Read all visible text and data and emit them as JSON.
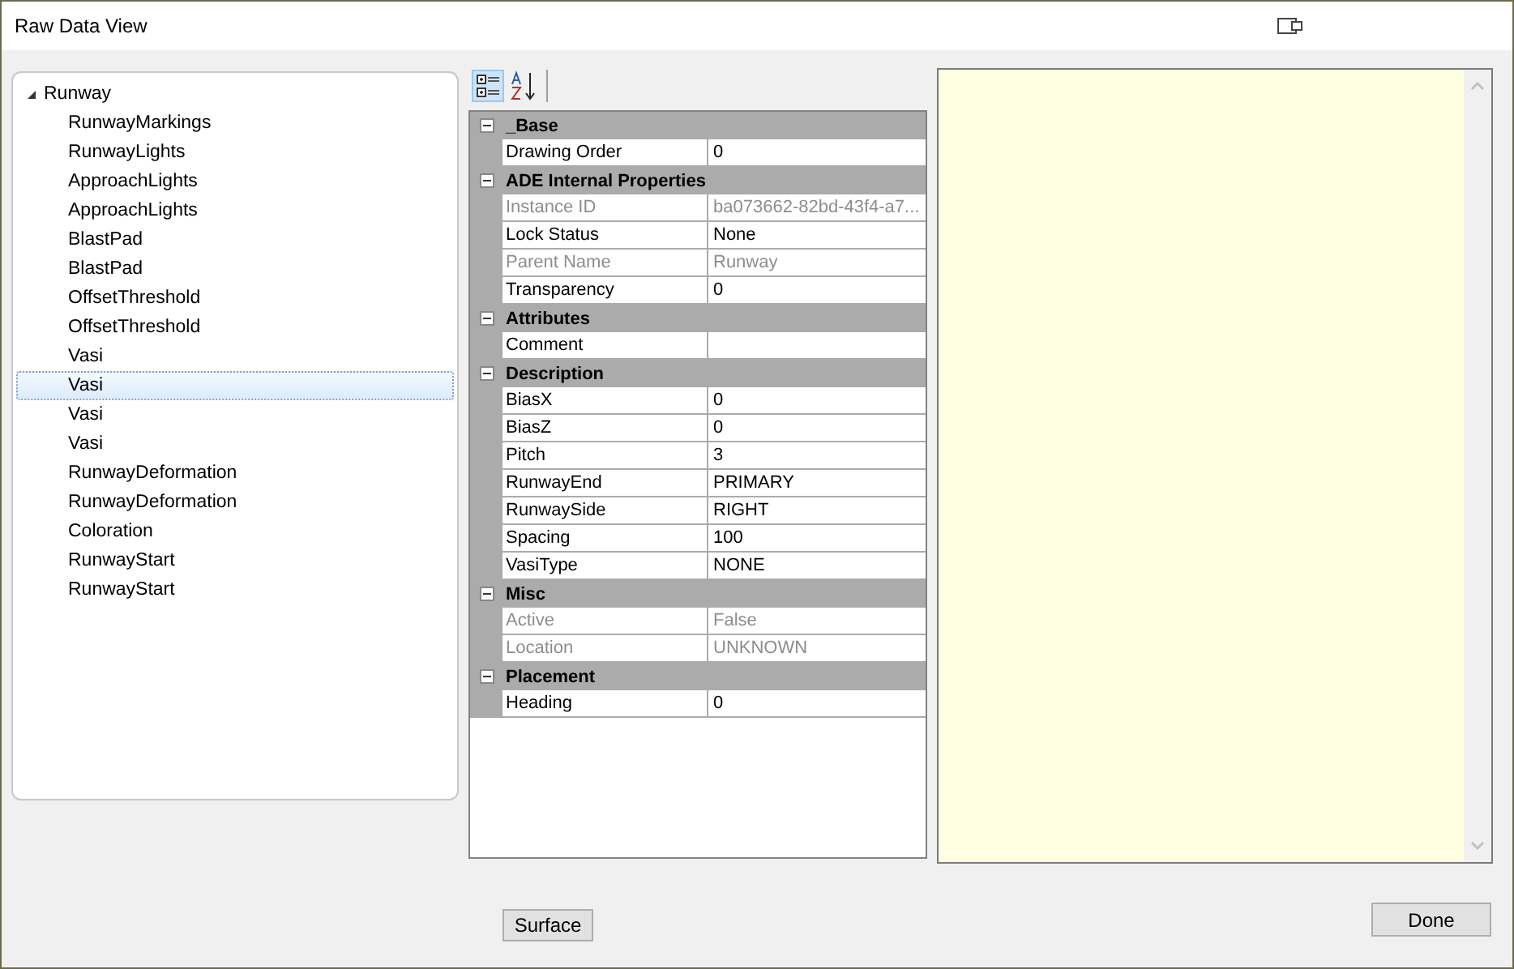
{
  "window": {
    "title": "Raw Data View"
  },
  "tree": {
    "label": "Runway",
    "expanded": true,
    "children": [
      {
        "label": "RunwayMarkings",
        "selected": false
      },
      {
        "label": "RunwayLights",
        "selected": false
      },
      {
        "label": "ApproachLights",
        "selected": false
      },
      {
        "label": "ApproachLights",
        "selected": false
      },
      {
        "label": "BlastPad",
        "selected": false
      },
      {
        "label": "BlastPad",
        "selected": false
      },
      {
        "label": "OffsetThreshold",
        "selected": false
      },
      {
        "label": "OffsetThreshold",
        "selected": false
      },
      {
        "label": "Vasi",
        "selected": false
      },
      {
        "label": "Vasi",
        "selected": true
      },
      {
        "label": "Vasi",
        "selected": false
      },
      {
        "label": "Vasi",
        "selected": false
      },
      {
        "label": "RunwayDeformation",
        "selected": false
      },
      {
        "label": "RunwayDeformation",
        "selected": false
      },
      {
        "label": "Coloration",
        "selected": false
      },
      {
        "label": "RunwayStart",
        "selected": false
      },
      {
        "label": "RunwayStart",
        "selected": false
      }
    ]
  },
  "property_toolbar": [
    {
      "kind": "categorized",
      "selected": true
    },
    {
      "kind": "alphabetical",
      "selected": false
    }
  ],
  "properties": [
    {
      "category": "_Base",
      "expanded": true,
      "rows": [
        {
          "name": "Drawing Order",
          "value": "0",
          "disabled": false
        }
      ]
    },
    {
      "category": "ADE Internal Properties",
      "expanded": true,
      "rows": [
        {
          "name": "Instance ID",
          "value": "ba073662-82bd-43f4-a7...",
          "disabled": true
        },
        {
          "name": "Lock Status",
          "value": "None",
          "disabled": false
        },
        {
          "name": "Parent Name",
          "value": "Runway",
          "disabled": true
        },
        {
          "name": "Transparency",
          "value": "0",
          "disabled": false
        }
      ]
    },
    {
      "category": "Attributes",
      "expanded": true,
      "rows": [
        {
          "name": "Comment",
          "disabled": false
        }
      ]
    },
    {
      "category": "Description",
      "expanded": true,
      "rows": [
        {
          "name": "BiasX",
          "value": "0",
          "disabled": false
        },
        {
          "name": "BiasZ",
          "value": "0",
          "disabled": false
        },
        {
          "name": "Pitch",
          "value": "3",
          "disabled": false
        },
        {
          "name": "RunwayEnd",
          "value": "PRIMARY",
          "disabled": false
        },
        {
          "name": "RunwaySide",
          "value": "RIGHT",
          "disabled": false
        },
        {
          "name": "Spacing",
          "value": "100",
          "disabled": false
        },
        {
          "name": "VasiType",
          "value": "NONE",
          "disabled": false
        }
      ]
    },
    {
      "category": "Misc",
      "expanded": true,
      "rows": [
        {
          "name": "Active",
          "value": "False",
          "disabled": true
        },
        {
          "name": "Location",
          "value": "UNKNOWN",
          "disabled": true
        }
      ]
    },
    {
      "category": "Placement",
      "expanded": true,
      "rows": [
        {
          "name": "Heading",
          "value": "0",
          "disabled": false
        }
      ]
    }
  ],
  "buttons": [
    {
      "label": "Surface"
    },
    {
      "label": "Done"
    }
  ]
}
